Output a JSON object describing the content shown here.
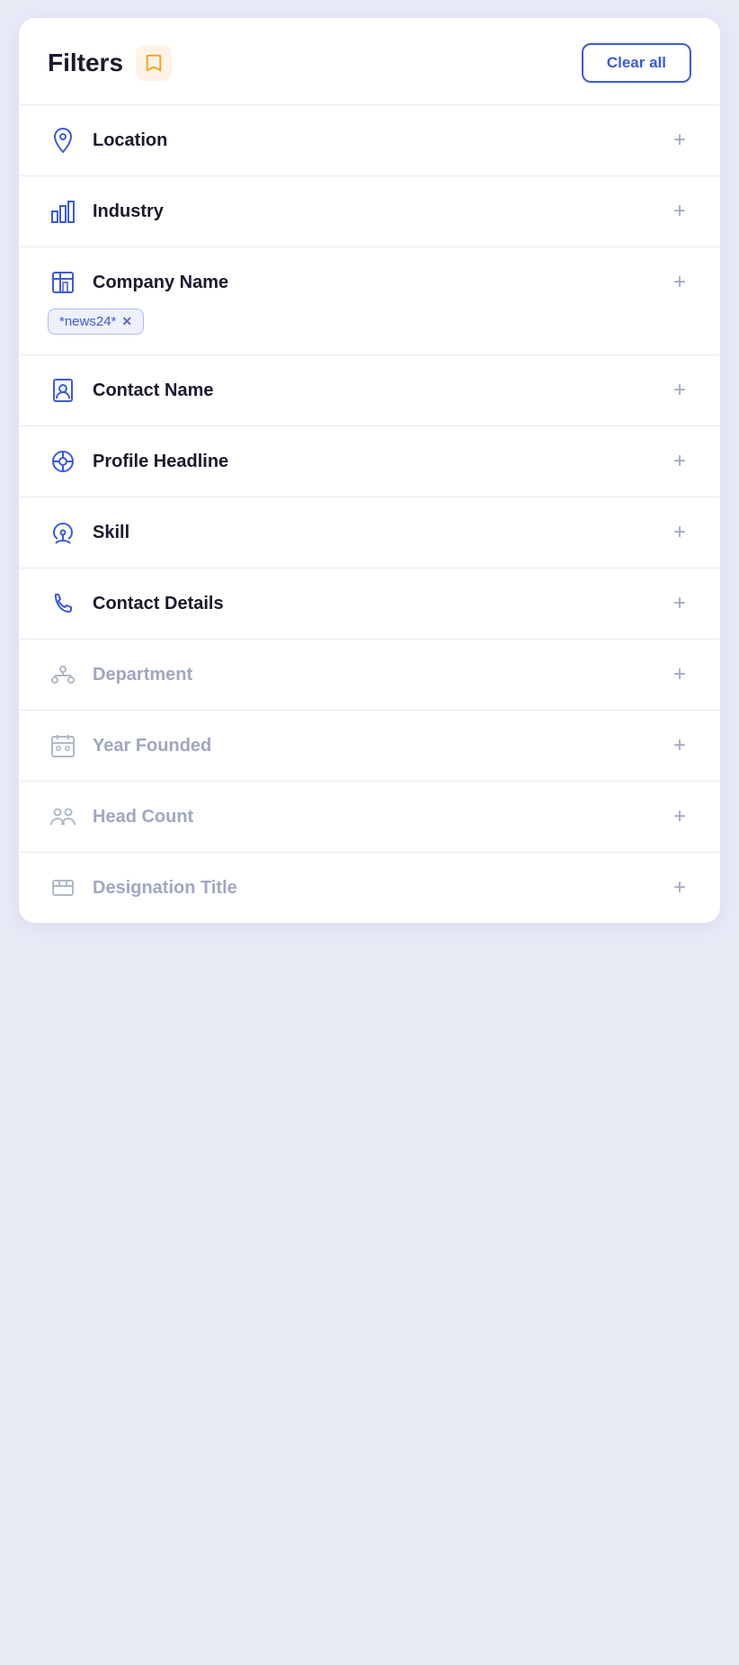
{
  "header": {
    "title": "Filters",
    "clear_all_label": "Clear all",
    "bookmark_icon": "bookmark-icon"
  },
  "filters": [
    {
      "id": "location",
      "label": "Location",
      "icon": "location-icon",
      "active": true,
      "tags": []
    },
    {
      "id": "industry",
      "label": "Industry",
      "icon": "industry-icon",
      "active": true,
      "tags": []
    },
    {
      "id": "company-name",
      "label": "Company Name",
      "icon": "company-icon",
      "active": true,
      "tags": [
        "*news24*"
      ]
    },
    {
      "id": "contact-name",
      "label": "Contact Name",
      "icon": "contact-icon",
      "active": true,
      "tags": []
    },
    {
      "id": "profile-headline",
      "label": "Profile Headline",
      "icon": "profile-icon",
      "active": true,
      "tags": []
    },
    {
      "id": "skill",
      "label": "Skill",
      "icon": "skill-icon",
      "active": true,
      "tags": []
    },
    {
      "id": "contact-details",
      "label": "Contact Details",
      "icon": "contact-details-icon",
      "active": true,
      "tags": []
    },
    {
      "id": "department",
      "label": "Department",
      "icon": "department-icon",
      "active": false,
      "tags": []
    },
    {
      "id": "year-founded",
      "label": "Year Founded",
      "icon": "year-founded-icon",
      "active": false,
      "tags": []
    },
    {
      "id": "head-count",
      "label": "Head Count",
      "icon": "head-count-icon",
      "active": false,
      "tags": []
    },
    {
      "id": "designation-title",
      "label": "Designation Title",
      "icon": "designation-icon",
      "active": false,
      "tags": []
    }
  ]
}
